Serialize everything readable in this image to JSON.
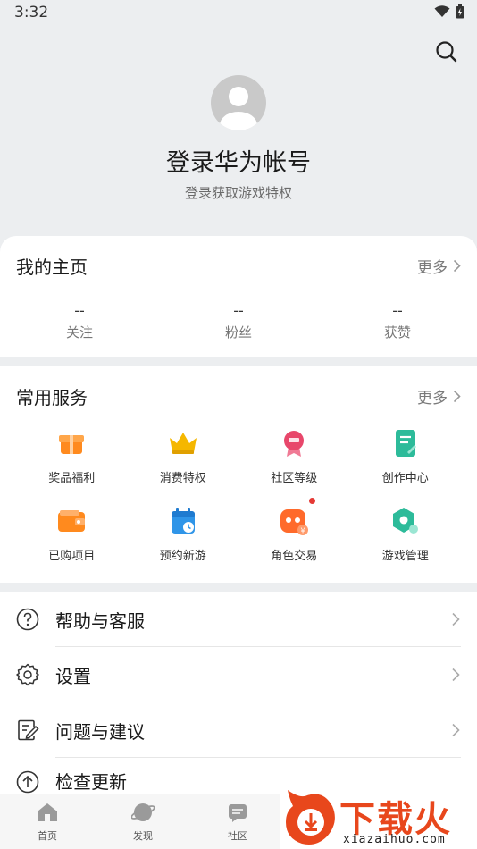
{
  "status_bar": {
    "time": "3:32"
  },
  "profile": {
    "title": "登录华为帐号",
    "subtitle": "登录获取游戏特权"
  },
  "home": {
    "title": "我的主页",
    "more": "更多",
    "stats": [
      {
        "value": "--",
        "label": "关注"
      },
      {
        "value": "--",
        "label": "粉丝"
      },
      {
        "value": "--",
        "label": "获赞"
      }
    ]
  },
  "services": {
    "title": "常用服务",
    "more": "更多",
    "items": [
      {
        "label": "奖品福利",
        "icon": "gift-icon",
        "color": "#ff8a1e"
      },
      {
        "label": "消费特权",
        "icon": "crown-icon",
        "color": "#f5b700"
      },
      {
        "label": "社区等级",
        "icon": "medal-icon",
        "color": "#e8476b"
      },
      {
        "label": "创作中心",
        "icon": "document-edit-icon",
        "color": "#2dbb9a"
      },
      {
        "label": "已购项目",
        "icon": "wallet-icon",
        "color": "#ff8a1e"
      },
      {
        "label": "预约新游",
        "icon": "calendar-icon",
        "color": "#2f95e8"
      },
      {
        "label": "角色交易",
        "icon": "game-character-icon",
        "color": "#ff6a2b"
      },
      {
        "label": "游戏管理",
        "icon": "hexagon-manage-icon",
        "color": "#2dbb9a"
      }
    ]
  },
  "menu": [
    {
      "label": "帮助与客服",
      "icon": "help-icon"
    },
    {
      "label": "设置",
      "icon": "gear-icon"
    },
    {
      "label": "问题与建议",
      "icon": "feedback-icon"
    },
    {
      "label": "检查更新",
      "icon": "update-icon"
    }
  ],
  "bottom_nav": [
    {
      "label": "首页",
      "icon": "home-icon"
    },
    {
      "label": "发现",
      "icon": "discover-icon"
    },
    {
      "label": "社区",
      "icon": "community-icon"
    }
  ],
  "watermark": {
    "text": "下载火",
    "url": "xiazaihuo.com"
  }
}
